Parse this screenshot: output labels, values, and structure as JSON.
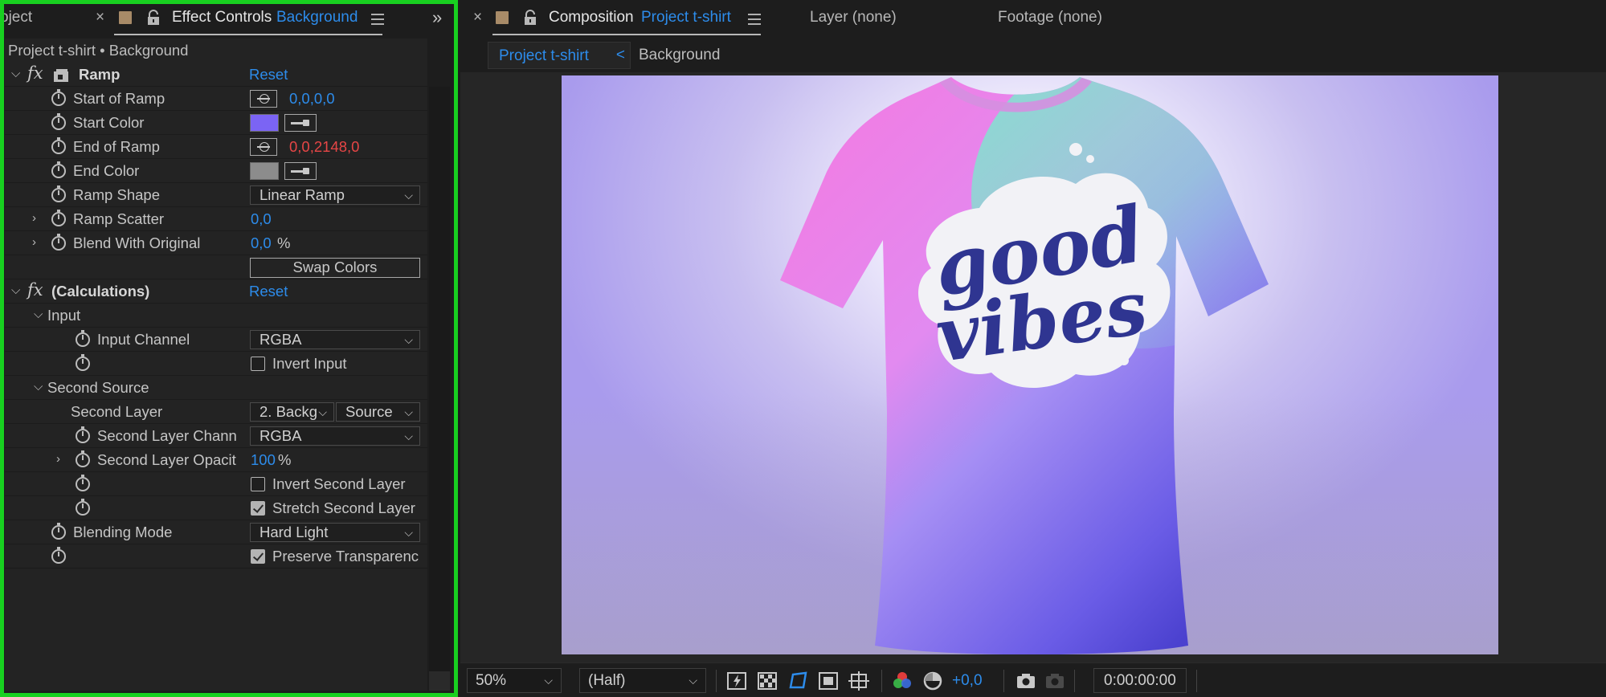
{
  "left_panel": {
    "tab_project_partial": "oject",
    "tab_title": "Effect Controls",
    "tab_layer": "Background",
    "breadcrumb": "Project t-shirt • Background"
  },
  "ramp": {
    "name": "Ramp",
    "reset": "Reset",
    "start_of_ramp_label": "Start of Ramp",
    "start_of_ramp_value": "0,0,0,0",
    "start_color_label": "Start Color",
    "start_color": "#7b64f4",
    "end_of_ramp_label": "End of Ramp",
    "end_of_ramp_value": "0,0,2148,0",
    "end_color_label": "End Color",
    "end_color": "#8c8c8c",
    "ramp_shape_label": "Ramp Shape",
    "ramp_shape_value": "Linear Ramp",
    "ramp_scatter_label": "Ramp Scatter",
    "ramp_scatter_value": "0,0",
    "blend_label": "Blend With Original",
    "blend_value": "0,0",
    "blend_unit": "%",
    "swap_colors": "Swap Colors"
  },
  "calculations": {
    "name": "(Calculations)",
    "reset": "Reset",
    "input_group": "Input",
    "input_channel_label": "Input Channel",
    "input_channel_value": "RGBA",
    "invert_input_label": "Invert Input",
    "invert_input_checked": false,
    "second_source_group": "Second Source",
    "second_layer_label": "Second Layer",
    "second_layer_value": "2. Backg",
    "second_layer_source": "Source",
    "second_layer_channel_label": "Second Layer Chann",
    "second_layer_channel_value": "RGBA",
    "second_layer_opacity_label": "Second Layer Opacit",
    "second_layer_opacity_value": "100",
    "second_layer_opacity_unit": "%",
    "invert_second_label": "Invert Second Layer",
    "invert_second_checked": false,
    "stretch_second_label": "Stretch Second Layer",
    "stretch_second_checked": true,
    "blending_mode_label": "Blending Mode",
    "blending_mode_value": "Hard Light",
    "preserve_transparency_label": "Preserve Transparenc",
    "preserve_transparency_checked": true
  },
  "right_panel": {
    "tab_title": "Composition",
    "tab_comp": "Project t-shirt",
    "tab_layer": "Layer (none)",
    "tab_footage": "Footage (none)",
    "crumb_active": "Project t-shirt",
    "crumb_arrow": "<",
    "crumb_2": "Background"
  },
  "artwork": {
    "line1": "good",
    "line2": "vibes"
  },
  "bottom_bar": {
    "zoom": "50%",
    "resolution": "(Half)",
    "exposure": "+0,0",
    "timecode": "0:00:00:00"
  },
  "colors": {
    "accent_blue": "#2d8ceb",
    "keyframed_red": "#e64646",
    "highlight_green": "#18d020"
  }
}
